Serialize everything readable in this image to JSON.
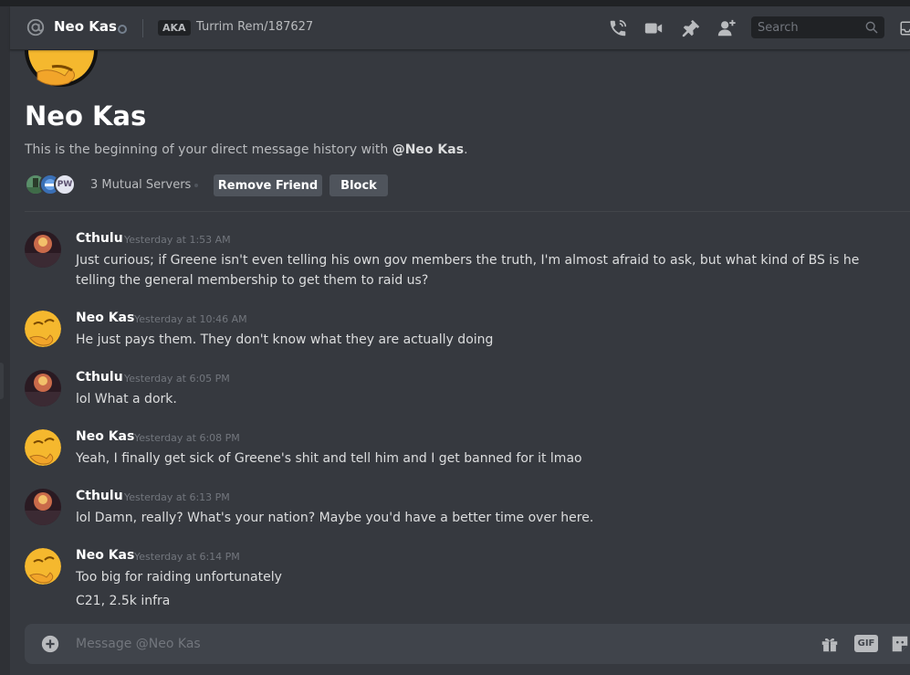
{
  "header": {
    "name": "Neo Kas",
    "aka_badge": "AKA",
    "aka_value": "Turrim Rem/187627",
    "search_placeholder": "Search"
  },
  "profile": {
    "name": "Neo Kas",
    "desc_prefix": "This is the beginning of your direct message history with ",
    "desc_mention": "@Neo Kas",
    "desc_suffix": ".",
    "mutual_servers": [
      {
        "label": "",
        "color": "#5a8f6a"
      },
      {
        "label": "",
        "color": "#3a6fb5"
      },
      {
        "label": "PW",
        "color": "#e3e5f0"
      }
    ],
    "mutual_label": "3 Mutual Servers",
    "remove_friend_label": "Remove Friend",
    "block_label": "Block"
  },
  "messages": [
    {
      "author": "Cthulu",
      "time": "Yesterday at 1:53 AM",
      "lines": [
        "Just curious; if Greene isn't even telling his own gov members the truth, I'm almost afraid to ask, but what kind of BS is he telling the general membership to get them to raid us?"
      ]
    },
    {
      "author": "Neo Kas",
      "time": "Yesterday at 10:46 AM",
      "lines": [
        "He just pays them. They don't know what they are actually doing"
      ]
    },
    {
      "author": "Cthulu",
      "time": "Yesterday at 6:05 PM",
      "lines": [
        "lol What a dork."
      ]
    },
    {
      "author": "Neo Kas",
      "time": "Yesterday at 6:08 PM",
      "lines": [
        "Yeah, I finally get sick of Greene's shit and tell him and I get banned for it lmao"
      ]
    },
    {
      "author": "Cthulu",
      "time": "Yesterday at 6:13 PM",
      "lines": [
        "lol Damn, really? What's your nation? Maybe you'd have a better time over here."
      ]
    },
    {
      "author": "Neo Kas",
      "time": "Yesterday at 6:14 PM",
      "lines": [
        "Too big for raiding unfortunately",
        "C21, 2.5k infra"
      ]
    }
  ],
  "composer": {
    "placeholder": "Message @Neo Kas",
    "gif_label": "GIF"
  },
  "colors": {
    "background": "#36393f",
    "header_bg": "#36393f",
    "composer_bg": "#40444b",
    "button_bg": "#4f545c",
    "text_primary": "#dcddde",
    "text_muted": "#72767d"
  },
  "icons": [
    "at-sign-icon",
    "offline-status-icon",
    "call-icon",
    "video-icon",
    "pin-icon",
    "add-friend-icon",
    "search-icon",
    "inbox-icon",
    "plus-icon",
    "gift-icon",
    "sticker-icon"
  ]
}
